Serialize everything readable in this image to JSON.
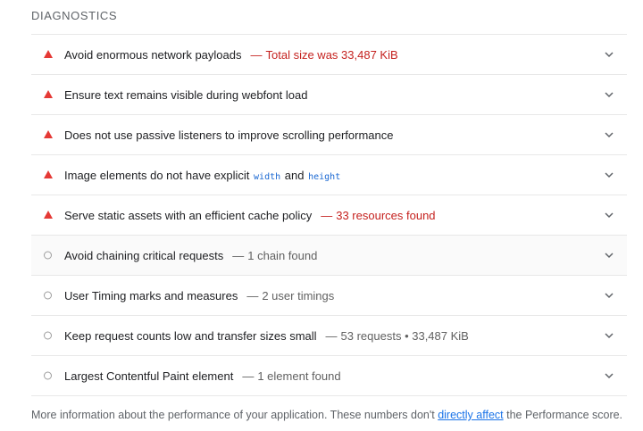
{
  "section": {
    "title": "DIAGNOSTICS"
  },
  "audits": [
    {
      "status": "fail",
      "title": "Avoid enormous network payloads",
      "value": "Total size was 33,487 KiB"
    },
    {
      "status": "fail",
      "title": "Ensure text remains visible during webfont load",
      "value": ""
    },
    {
      "status": "fail",
      "title": "Does not use passive listeners to improve scrolling performance",
      "value": ""
    },
    {
      "status": "fail",
      "title_pre": "Image elements do not have explicit",
      "code1": "width",
      "title_mid": "and",
      "code2": "height",
      "value": ""
    },
    {
      "status": "fail",
      "title": "Serve static assets with an efficient cache policy",
      "value": "33 resources found"
    },
    {
      "status": "neutral",
      "title": "Avoid chaining critical requests",
      "value": "1 chain found"
    },
    {
      "status": "neutral",
      "title": "User Timing marks and measures",
      "value": "2 user timings"
    },
    {
      "status": "neutral",
      "title": "Keep request counts low and transfer sizes small",
      "value": "53 requests • 33,487 KiB"
    },
    {
      "status": "neutral",
      "title": "Largest Contentful Paint element",
      "value": "1 element found"
    }
  ],
  "footer": {
    "text_before": "More information about the performance of your application. These numbers don't",
    "link": "directly affect",
    "text_after": "the Performance score."
  },
  "colors": {
    "fail": "#e53935",
    "fail_text": "#c5221f",
    "neutral": "#9e9e9e",
    "link": "#1a73e8"
  },
  "icons": {
    "fail": "warning-triangle-icon",
    "neutral": "circle-outline-icon",
    "expand": "chevron-down-icon"
  }
}
